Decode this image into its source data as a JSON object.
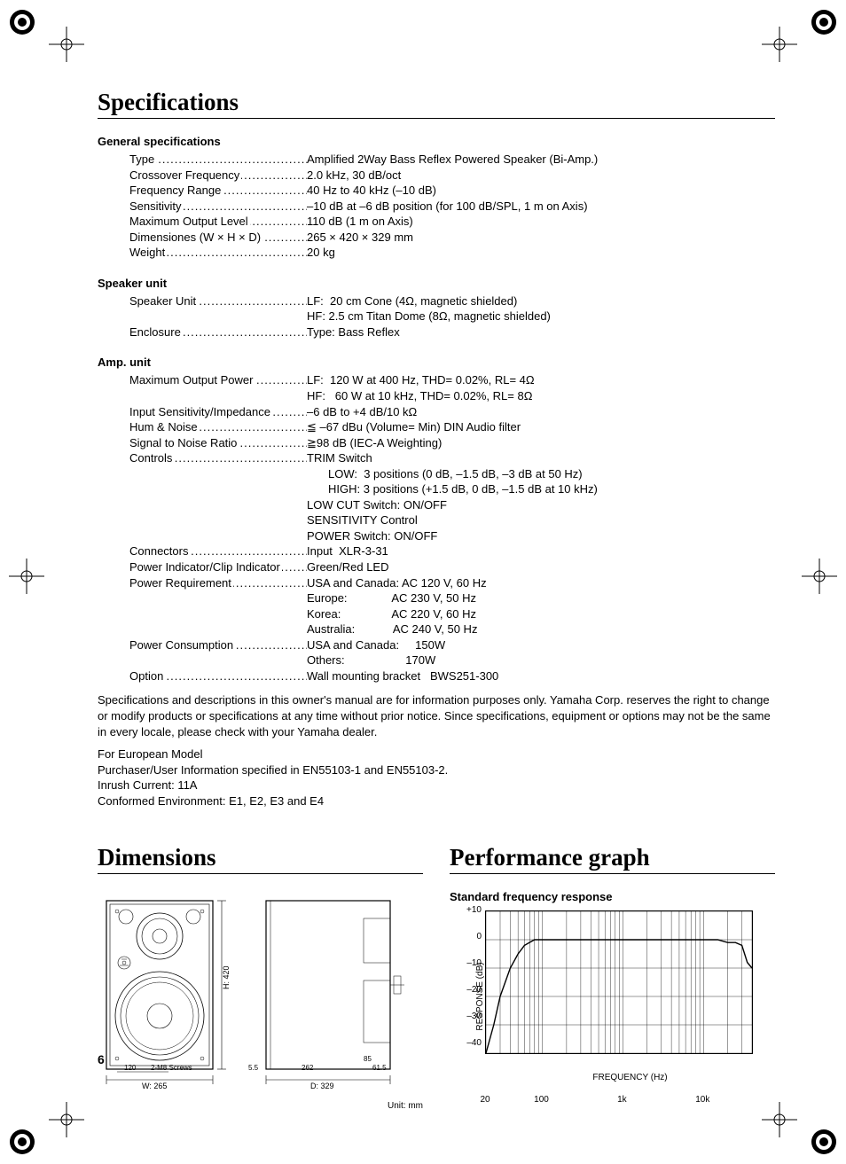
{
  "pagenum": "6",
  "headings": {
    "specs": "Specifications",
    "dims": "Dimensions",
    "perf": "Performance graph"
  },
  "general": {
    "title": "General specifications",
    "rows": [
      {
        "label": "Type",
        "value": "Amplified 2Way Bass Reflex Powered Speaker (Bi-Amp.)"
      },
      {
        "label": "Crossover Frequency",
        "value": "2.0 kHz, 30 dB/oct"
      },
      {
        "label": "Frequency Range",
        "value": "40 Hz to 40 kHz (–10 dB)"
      },
      {
        "label": "Sensitivity",
        "value": "–10 dB at –6 dB position (for 100 dB/SPL, 1 m on Axis)"
      },
      {
        "label": "Maximum Output Level",
        "value": "110 dB (1 m on Axis)"
      },
      {
        "label": "Dimensiones (W × H × D)",
        "value": "265 × 420 × 329 mm"
      },
      {
        "label": "Weight",
        "value": "20 kg"
      }
    ]
  },
  "speaker": {
    "title": "Speaker unit",
    "rows": [
      {
        "label": "Speaker Unit",
        "value": "LF:  20 cm Cone (4Ω, magnetic shielded)"
      },
      {
        "cont": true,
        "value": "HF: 2.5 cm Titan Dome (8Ω, magnetic shielded)"
      },
      {
        "label": "Enclosure",
        "value": "Type: Bass Reflex"
      }
    ]
  },
  "amp": {
    "title": "Amp. unit",
    "rows": [
      {
        "label": "Maximum Output Power",
        "value": "LF:  120 W at 400 Hz, THD= 0.02%, RL= 4Ω"
      },
      {
        "cont": true,
        "value": "HF:   60 W at 10 kHz, THD= 0.02%, RL= 8Ω"
      },
      {
        "label": "Input Sensitivity/Impedance",
        "value": "–6 dB to +4 dB/10 kΩ"
      },
      {
        "label": "Hum & Noise",
        "value": "≦ –67 dBu (Volume= Min) DIN Audio filter"
      },
      {
        "label": "Signal to Noise Ratio",
        "value": "≧98 dB (IEC-A Weighting)"
      },
      {
        "label": "Controls",
        "value": "TRIM Switch"
      },
      {
        "cont": true,
        "sub": true,
        "value": "LOW:  3 positions (0 dB, –1.5 dB, –3 dB at 50 Hz)"
      },
      {
        "cont": true,
        "sub": true,
        "value": "HIGH: 3 positions (+1.5 dB, 0 dB, –1.5 dB at 10 kHz)"
      },
      {
        "cont": true,
        "value": "LOW CUT Switch: ON/OFF"
      },
      {
        "cont": true,
        "value": "SENSITIVITY Control"
      },
      {
        "cont": true,
        "value": "POWER Switch: ON/OFF"
      },
      {
        "label": "Connectors",
        "value": "Input  XLR-3-31"
      },
      {
        "label": "Power Indicator/Clip Indicator",
        "value": "Green/Red LED"
      },
      {
        "label": "Power Requirement",
        "value": "USA and Canada: AC 120 V, 60 Hz"
      },
      {
        "cont": true,
        "value": "Europe:              AC 230 V, 50 Hz"
      },
      {
        "cont": true,
        "value": "Korea:                AC 220 V, 60 Hz"
      },
      {
        "cont": true,
        "value": "Australia:            AC 240 V, 50 Hz"
      },
      {
        "label": "Power Consumption",
        "value": "USA and Canada:     150W"
      },
      {
        "cont": true,
        "value": "Others:                   170W"
      },
      {
        "label": "Option",
        "value": "Wall mounting bracket   BWS251-300"
      }
    ]
  },
  "disclaimer": "Specifications and descriptions in this owner's manual are for information purposes only. Yamaha Corp. reserves the right to change or modify products or specifications at any time without prior notice. Since specifications, equipment or options may not be the same in every locale, please check with your Yamaha dealer.",
  "euro": [
    "For European Model",
    "Purchaser/User Information specified in EN55103-1 and EN55103-2.",
    "Inrush Current: 11A",
    "Conformed Environment: E1, E2, E3 and E4"
  ],
  "dims": {
    "labels": {
      "w": "W: 265",
      "h": "H: 420",
      "d": "D: 329",
      "front_dim": "120",
      "screws": "2-M8 Screws",
      "side_gap": "5.5",
      "side_inner": "262",
      "side_rear": "61.5",
      "rear_top": "85",
      "unit": "Unit: mm"
    }
  },
  "chart_title": "Standard frequency response",
  "chart_data": {
    "type": "line",
    "xlabel": "FREQUENCY (Hz)",
    "ylabel": "RESPONSE (dB)",
    "xscale": "log",
    "xlim": [
      20,
      40000
    ],
    "ylim": [
      -40,
      10
    ],
    "yticks": [
      "+10",
      "0",
      "–10",
      "–20",
      "–30",
      "–40"
    ],
    "xticks": [
      {
        "v": 20,
        "l": "20"
      },
      {
        "v": 100,
        "l": "100"
      },
      {
        "v": 1000,
        "l": "1k"
      },
      {
        "v": 10000,
        "l": "10k"
      }
    ],
    "series": [
      {
        "name": "response",
        "x": [
          20,
          25,
          30,
          40,
          50,
          60,
          80,
          100,
          150,
          200,
          300,
          500,
          1000,
          2000,
          5000,
          10000,
          15000,
          20000,
          25000,
          30000,
          35000,
          40000
        ],
        "y": [
          -40,
          -30,
          -20,
          -10,
          -5,
          -2,
          0,
          0,
          0,
          0,
          0,
          0,
          0,
          0,
          0,
          0,
          0,
          -1,
          -1,
          -2,
          -8,
          -10
        ]
      }
    ]
  }
}
